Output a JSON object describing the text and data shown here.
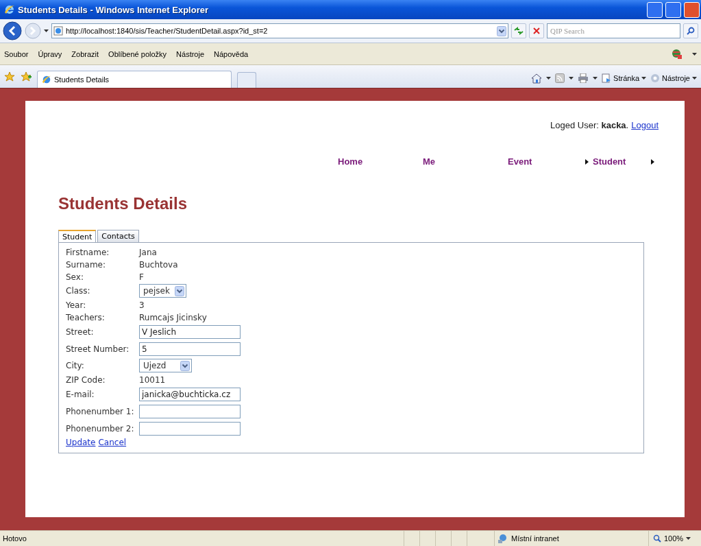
{
  "window": {
    "title": "Students Details - Windows Internet Explorer"
  },
  "address_bar": {
    "url": "http://localhost:1840/sis/Teacher/StudentDetail.aspx?id_st=2",
    "search_placeholder": "QIP Search"
  },
  "menu": [
    "Soubor",
    "Úpravy",
    "Zobrazit",
    "Oblíbené položky",
    "Nástroje",
    "Nápověda"
  ],
  "browser_tabs": [
    {
      "label": "Students Details",
      "selected": true
    }
  ],
  "command_bar": [
    "Stránka",
    "Nástroje"
  ],
  "page": {
    "user_line": "Loged User: **kacka**.",
    "logout": "Logout",
    "nav": [
      {
        "label": "Home",
        "submenu": false
      },
      {
        "label": "Me",
        "submenu": false
      },
      {
        "label": "Event",
        "submenu": true
      },
      {
        "label": "Student",
        "submenu": true
      }
    ],
    "heading": "Students Details",
    "tabs": [
      {
        "label": "Student",
        "selected": true
      },
      {
        "label": "Contacts",
        "selected": false
      }
    ],
    "fields": [
      {
        "label": "Firstname:",
        "kind": "text",
        "value": "Jana"
      },
      {
        "label": "Surname:",
        "kind": "text",
        "value": "Buchtova"
      },
      {
        "label": "Sex:",
        "kind": "text",
        "value": "F"
      },
      {
        "label": "Class:",
        "kind": "select",
        "value": "pejsek"
      },
      {
        "label": "Year:",
        "kind": "text",
        "value": "3"
      },
      {
        "label": "Teachers:",
        "kind": "text",
        "value": "Rumcajs Jicinsky"
      },
      {
        "label": "Street:",
        "kind": "input",
        "value": "V Jeslich"
      },
      {
        "label": "Street Number:",
        "kind": "input",
        "value": "5"
      },
      {
        "label": "City:",
        "kind": "select",
        "value": "Ujezd"
      },
      {
        "label": "ZIP Code:",
        "kind": "text",
        "value": "10011"
      },
      {
        "label": "E-mail:",
        "kind": "input",
        "value": "janicka@buchticka.cz"
      },
      {
        "label": "Phonenumber 1:",
        "kind": "input"
      },
      {
        "label": "Phonenumber 2:",
        "kind": "input"
      }
    ],
    "actions": [
      "Update",
      "Cancel"
    ]
  },
  "status_bar": {
    "text": "Hotovo",
    "zone": "Místní intranet",
    "zoom": "100%"
  }
}
